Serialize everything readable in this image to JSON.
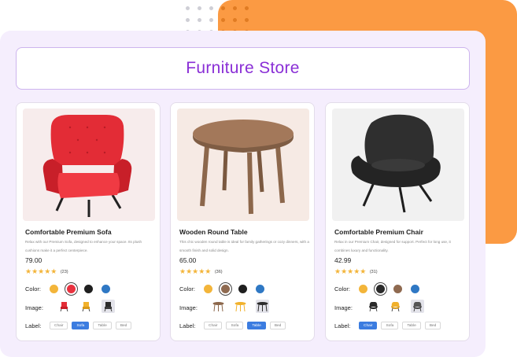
{
  "store_title": "Furniture Store",
  "labels": {
    "color": "Color:",
    "image": "Image:",
    "label": "Label:"
  },
  "colors": {
    "orange": "#fb9a43",
    "panel": "#f5eefd",
    "accent_purple": "#8a2fd6",
    "star": "#f3b53a",
    "label_selected": "#3b7ce0"
  },
  "products": [
    {
      "name": "Comfortable Premium Sofa",
      "description": "Relax with our Premium Sofa, designed to enhance your space. Its plush cushions make it a perfect centerpiece.",
      "price": "79.00",
      "stars": "★★★★★",
      "rating_count": "(23)",
      "color_options": [
        "#f3b53a",
        "#e8323f",
        "#1f1f1f",
        "#2f78c4"
      ],
      "selected_color": 1,
      "image_options": [
        "red-chair-thumb",
        "yellow-chair-thumb",
        "black-chair-thumb"
      ],
      "selected_image": 2,
      "label_options": [
        "Chair",
        "Sofa",
        "Table",
        "Bed"
      ],
      "selected_label": 1
    },
    {
      "name": "Wooden Round Table",
      "description": "This chic wooden round table is ideal for family gatherings or cozy dinners, with a smooth finish and solid design.",
      "price": "65.00",
      "stars": "★★★★★",
      "rating_count": "(36)",
      "color_options": [
        "#f3b53a",
        "#8f6a50",
        "#1f1f1f",
        "#2f78c4"
      ],
      "selected_color": 1,
      "image_options": [
        "brown-table-thumb",
        "yellow-table-thumb",
        "black-table-thumb"
      ],
      "selected_image": 2,
      "label_options": [
        "Chair",
        "Sofa",
        "Table",
        "Bed"
      ],
      "selected_label": 2
    },
    {
      "name": "Comfortable Premium Chair",
      "description": "Relax in our Premium Chair, designed for support. Perfect for long use, it combines luxury and functionality.",
      "price": "42.99",
      "stars": "★★★★★",
      "rating_count": "(31)",
      "color_options": [
        "#f3b53a",
        "#2a2a2a",
        "#8f6a50",
        "#2f78c4"
      ],
      "selected_color": 1,
      "image_options": [
        "black-chair-thumb",
        "yellow-chair-thumb",
        "gray-chair-thumb"
      ],
      "selected_image": 2,
      "label_options": [
        "Chair",
        "Sofa",
        "Table",
        "Bed"
      ],
      "selected_label": 0
    }
  ]
}
